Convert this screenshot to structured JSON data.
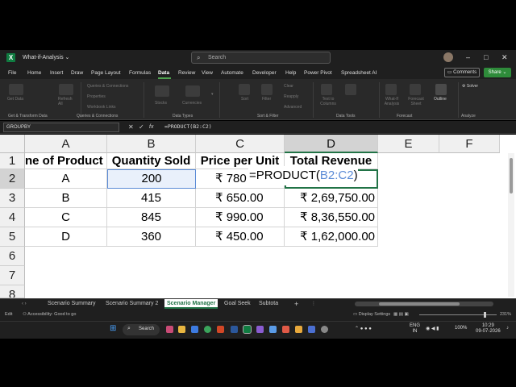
{
  "app": {
    "logo": "X",
    "title": "What-if-Analysis",
    "search_placeholder": "Search",
    "search_icon": "search-icon"
  },
  "window": {
    "minimize": "–",
    "maximize": "□",
    "close": "✕"
  },
  "menu": [
    "File",
    "Home",
    "Insert",
    "Draw",
    "Page Layout",
    "Formulas",
    "Data",
    "Review",
    "View",
    "Automate",
    "Developer",
    "Help",
    "Power Pivot",
    "Spreadsheet AI"
  ],
  "menu_active": "Data",
  "comments_label": "Comments",
  "share_label": "Share",
  "ribbon": {
    "get_data": "Get Data",
    "refresh_all": "Refresh All",
    "queries_items": [
      "Queries & Connections",
      "Properties",
      "Workbook Links"
    ],
    "stocks": "Stocks",
    "currencies": "Currencies",
    "sort": "Sort",
    "filter": "Filter",
    "filter_items": [
      "Clear",
      "Reapply",
      "Advanced"
    ],
    "text_to_columns": "Text to Columns",
    "what_if": "What-If Analysis",
    "forecast_sheet": "Forecast Sheet",
    "outline": "Outline",
    "solver": "Solver",
    "groups": [
      "Get & Transform Data",
      "Queries & Connections",
      "Data Types",
      "Sort & Filter",
      "Data Tools",
      "Forecast",
      "Analyze"
    ]
  },
  "formula_bar": {
    "name_box": "GROUPBY",
    "cancel": "✕",
    "enter": "✓",
    "fx": "fx",
    "formula": "=PRODUCT(B2:C2)"
  },
  "columns": [
    "A",
    "B",
    "C",
    "D",
    "E",
    "F"
  ],
  "rows": [
    "1",
    "2",
    "3",
    "4",
    "5",
    "6",
    "7",
    "8"
  ],
  "table": {
    "headers": [
      "ne of Product",
      "Quantity Sold",
      "Price per Unit",
      "Total Revenue"
    ],
    "rows": [
      [
        "A",
        "200",
        "₹ 780",
        ""
      ],
      [
        "B",
        "415",
        "₹ 650.00",
        "₹ 2,69,750.00"
      ],
      [
        "C",
        "845",
        "₹ 990.00",
        "₹ 8,36,550.00"
      ],
      [
        "D",
        "360",
        "₹ 450.00",
        "₹ 1,62,000.00"
      ]
    ]
  },
  "edit_cell": {
    "prefix": "=PRODUCT(",
    "ref": "B2:C2",
    "suffix": ")"
  },
  "sheet_tabs": [
    "Scenario Summary",
    "Scenario Summary 2",
    "Scenario Manager",
    "Goal Seek",
    "Subtota"
  ],
  "sheet_active": "Scenario Manager",
  "add_sheet": "+",
  "status": {
    "mode": "Edit",
    "accessibility": "Accessibility: Good to go",
    "display_settings": "Display Settings",
    "zoom": "231%"
  },
  "taskbar": {
    "search": "Search",
    "lang": "ENG",
    "region": "IN",
    "battery": "100%",
    "time": "10:29",
    "date": "09-07-2026"
  },
  "colors": {
    "excel_green": "#217346",
    "selection_blue": "#5b8bd6",
    "share_green": "#2e8b3a"
  }
}
